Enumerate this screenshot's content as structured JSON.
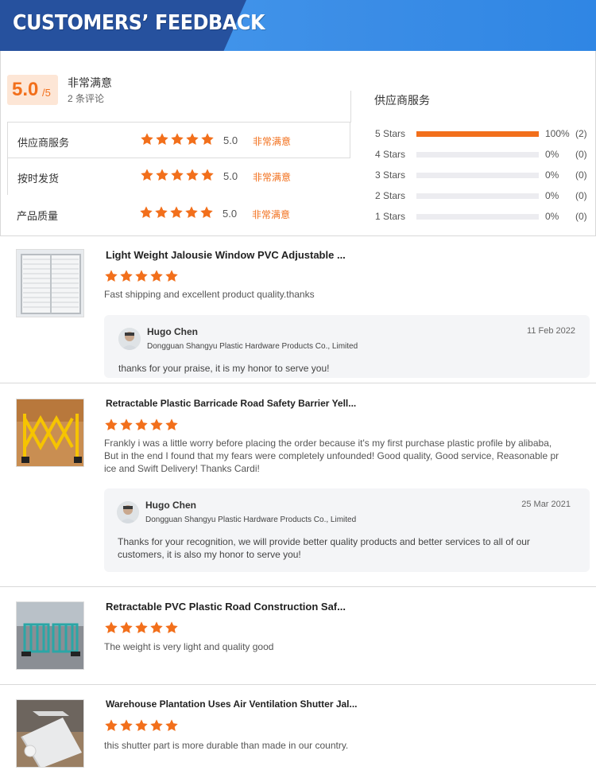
{
  "banner": {
    "title": "CUSTOMERS’ FEEDBACK"
  },
  "summary": {
    "score": "5.0",
    "score_max": "/5",
    "overall_label": "非常满意",
    "review_count": "2 条评论",
    "ratings": [
      {
        "label": "供应商服务",
        "value": "5.0",
        "level": "非常满意",
        "stars": 5
      },
      {
        "label": "按时发货",
        "value": "5.0",
        "level": "非常满意",
        "stars": 5
      },
      {
        "label": "产品质量",
        "value": "5.0",
        "level": "非常满意",
        "stars": 5
      }
    ],
    "distribution_title": "供应商服务",
    "distribution": [
      {
        "label": "5  Stars",
        "percent": 100,
        "percent_text": "100%",
        "count": "(2)"
      },
      {
        "label": "4  Stars",
        "percent": 0,
        "percent_text": "0%",
        "count": "(0)"
      },
      {
        "label": "3  Stars",
        "percent": 0,
        "percent_text": "0%",
        "count": "(0)"
      },
      {
        "label": "2  Stars",
        "percent": 0,
        "percent_text": "0%",
        "count": "(0)"
      },
      {
        "label": "1  Stars",
        "percent": 0,
        "percent_text": "0%",
        "count": "(0)"
      }
    ]
  },
  "reviews": [
    {
      "product": "Light Weight Jalousie Window PVC Adjustable ...",
      "stars": 5,
      "text": "Fast shipping and excellent product quality.thanks",
      "reply": {
        "name": "Hugo Chen",
        "company": "Dongguan Shangyu Plastic Hardware Products Co., Limited",
        "date": "11 Feb 2022",
        "message": "thanks for your praise, it is my honor to serve you!"
      }
    },
    {
      "product": "Retractable Plastic Barricade Road Safety Barrier Yell...",
      "stars": 5,
      "text": "Frankly i was a little worry before placing the order because it's my first purchase plastic profile by alibaba, But in the end I found that my fears were completely unfounded! Good quality, Good service, Reasonable pr ice and Swift Delivery! Thanks Cardi!",
      "reply": {
        "name": "Hugo Chen",
        "company": "Dongguan Shangyu Plastic Hardware Products Co., Limited",
        "date": "25 Mar 2021",
        "message": "Thanks for your recognition, we will provide better quality products and better services to all of our customers, it is also my honor to serve you!"
      }
    },
    {
      "product": "Retractable PVC Plastic Road Construction Saf...",
      "stars": 5,
      "text": "The weight is very light and quality good"
    },
    {
      "product": "Warehouse Plantation Uses Air Ventilation Shutter Jal...",
      "stars": 5,
      "text": "this shutter part is more durable than made in our country."
    }
  ],
  "colors": {
    "accent": "#f26f1b",
    "banner_dark": "#26519e",
    "banner_light": "#3b8de6"
  },
  "icons": {
    "star": "star-icon",
    "avatar": "user-avatar"
  }
}
